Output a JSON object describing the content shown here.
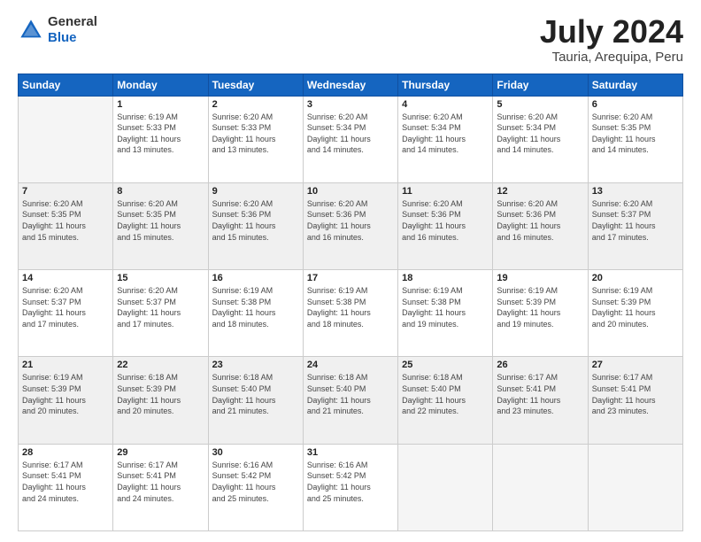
{
  "header": {
    "logo_general": "General",
    "logo_blue": "Blue",
    "title": "July 2024",
    "subtitle": "Tauria, Arequipa, Peru"
  },
  "columns": [
    "Sunday",
    "Monday",
    "Tuesday",
    "Wednesday",
    "Thursday",
    "Friday",
    "Saturday"
  ],
  "weeks": [
    [
      {
        "day": "",
        "info": ""
      },
      {
        "day": "1",
        "info": "Sunrise: 6:19 AM\nSunset: 5:33 PM\nDaylight: 11 hours\nand 13 minutes."
      },
      {
        "day": "2",
        "info": "Sunrise: 6:20 AM\nSunset: 5:33 PM\nDaylight: 11 hours\nand 13 minutes."
      },
      {
        "day": "3",
        "info": "Sunrise: 6:20 AM\nSunset: 5:34 PM\nDaylight: 11 hours\nand 14 minutes."
      },
      {
        "day": "4",
        "info": "Sunrise: 6:20 AM\nSunset: 5:34 PM\nDaylight: 11 hours\nand 14 minutes."
      },
      {
        "day": "5",
        "info": "Sunrise: 6:20 AM\nSunset: 5:34 PM\nDaylight: 11 hours\nand 14 minutes."
      },
      {
        "day": "6",
        "info": "Sunrise: 6:20 AM\nSunset: 5:35 PM\nDaylight: 11 hours\nand 14 minutes."
      }
    ],
    [
      {
        "day": "7",
        "info": "Sunrise: 6:20 AM\nSunset: 5:35 PM\nDaylight: 11 hours\nand 15 minutes."
      },
      {
        "day": "8",
        "info": "Sunrise: 6:20 AM\nSunset: 5:35 PM\nDaylight: 11 hours\nand 15 minutes."
      },
      {
        "day": "9",
        "info": "Sunrise: 6:20 AM\nSunset: 5:36 PM\nDaylight: 11 hours\nand 15 minutes."
      },
      {
        "day": "10",
        "info": "Sunrise: 6:20 AM\nSunset: 5:36 PM\nDaylight: 11 hours\nand 16 minutes."
      },
      {
        "day": "11",
        "info": "Sunrise: 6:20 AM\nSunset: 5:36 PM\nDaylight: 11 hours\nand 16 minutes."
      },
      {
        "day": "12",
        "info": "Sunrise: 6:20 AM\nSunset: 5:36 PM\nDaylight: 11 hours\nand 16 minutes."
      },
      {
        "day": "13",
        "info": "Sunrise: 6:20 AM\nSunset: 5:37 PM\nDaylight: 11 hours\nand 17 minutes."
      }
    ],
    [
      {
        "day": "14",
        "info": "Sunrise: 6:20 AM\nSunset: 5:37 PM\nDaylight: 11 hours\nand 17 minutes."
      },
      {
        "day": "15",
        "info": "Sunrise: 6:20 AM\nSunset: 5:37 PM\nDaylight: 11 hours\nand 17 minutes."
      },
      {
        "day": "16",
        "info": "Sunrise: 6:19 AM\nSunset: 5:38 PM\nDaylight: 11 hours\nand 18 minutes."
      },
      {
        "day": "17",
        "info": "Sunrise: 6:19 AM\nSunset: 5:38 PM\nDaylight: 11 hours\nand 18 minutes."
      },
      {
        "day": "18",
        "info": "Sunrise: 6:19 AM\nSunset: 5:38 PM\nDaylight: 11 hours\nand 19 minutes."
      },
      {
        "day": "19",
        "info": "Sunrise: 6:19 AM\nSunset: 5:39 PM\nDaylight: 11 hours\nand 19 minutes."
      },
      {
        "day": "20",
        "info": "Sunrise: 6:19 AM\nSunset: 5:39 PM\nDaylight: 11 hours\nand 20 minutes."
      }
    ],
    [
      {
        "day": "21",
        "info": "Sunrise: 6:19 AM\nSunset: 5:39 PM\nDaylight: 11 hours\nand 20 minutes."
      },
      {
        "day": "22",
        "info": "Sunrise: 6:18 AM\nSunset: 5:39 PM\nDaylight: 11 hours\nand 20 minutes."
      },
      {
        "day": "23",
        "info": "Sunrise: 6:18 AM\nSunset: 5:40 PM\nDaylight: 11 hours\nand 21 minutes."
      },
      {
        "day": "24",
        "info": "Sunrise: 6:18 AM\nSunset: 5:40 PM\nDaylight: 11 hours\nand 21 minutes."
      },
      {
        "day": "25",
        "info": "Sunrise: 6:18 AM\nSunset: 5:40 PM\nDaylight: 11 hours\nand 22 minutes."
      },
      {
        "day": "26",
        "info": "Sunrise: 6:17 AM\nSunset: 5:41 PM\nDaylight: 11 hours\nand 23 minutes."
      },
      {
        "day": "27",
        "info": "Sunrise: 6:17 AM\nSunset: 5:41 PM\nDaylight: 11 hours\nand 23 minutes."
      }
    ],
    [
      {
        "day": "28",
        "info": "Sunrise: 6:17 AM\nSunset: 5:41 PM\nDaylight: 11 hours\nand 24 minutes."
      },
      {
        "day": "29",
        "info": "Sunrise: 6:17 AM\nSunset: 5:41 PM\nDaylight: 11 hours\nand 24 minutes."
      },
      {
        "day": "30",
        "info": "Sunrise: 6:16 AM\nSunset: 5:42 PM\nDaylight: 11 hours\nand 25 minutes."
      },
      {
        "day": "31",
        "info": "Sunrise: 6:16 AM\nSunset: 5:42 PM\nDaylight: 11 hours\nand 25 minutes."
      },
      {
        "day": "",
        "info": ""
      },
      {
        "day": "",
        "info": ""
      },
      {
        "day": "",
        "info": ""
      }
    ]
  ]
}
